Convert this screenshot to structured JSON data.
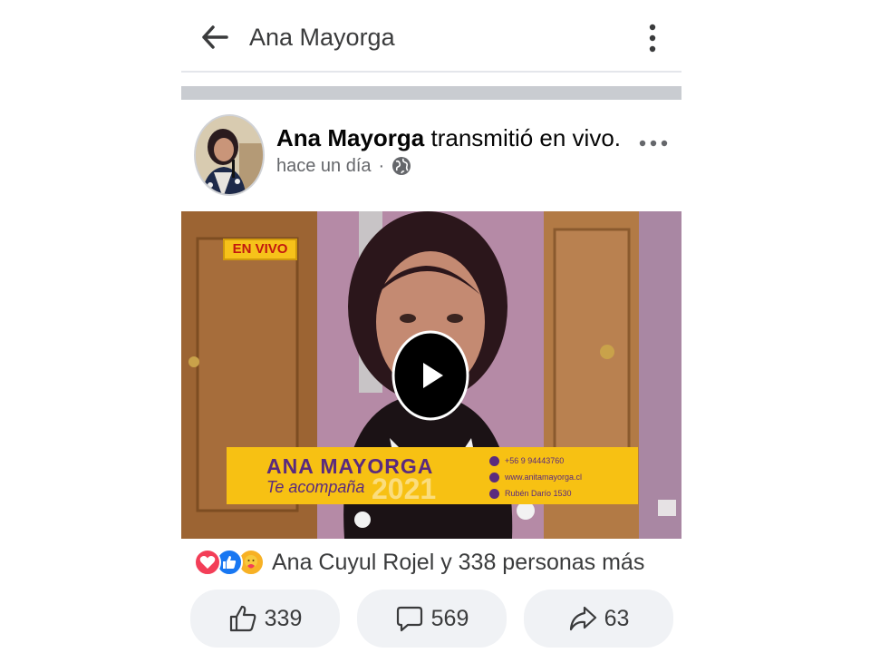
{
  "header": {
    "title": "Ana Mayorga",
    "back_icon": "arrow-left-icon",
    "menu_icon": "kebab-menu-icon"
  },
  "post": {
    "author": "Ana Mayorga",
    "action_text": " transmitió en vivo.",
    "timestamp": "hace un día",
    "separator": "·",
    "privacy_icon": "globe-icon",
    "more_icon": "more-horizontal-icon"
  },
  "video": {
    "live_badge": "EN VIVO",
    "banner_name": "ANA MAYORGA",
    "banner_subtitle": "Te acompaña",
    "banner_year": "2021",
    "contact_phone": "+56 9 94443760",
    "contact_web": "www.anitamayorga.cl",
    "contact_address": "Rubén Darío 1530",
    "play_icon": "play-icon"
  },
  "reactions": {
    "icons": [
      "love-reaction-icon",
      "like-reaction-icon",
      "care-reaction-icon"
    ],
    "summary": "Ana Cuyul Rojel y 338 personas más"
  },
  "actions": {
    "likes": "339",
    "comments": "569",
    "shares": "63"
  },
  "colors": {
    "like_blue": "#1877f2",
    "love_red": "#f33e58",
    "care_yellow": "#f7b125",
    "banner_yellow": "#f7c113",
    "banner_text": "#5a2a7e",
    "button_bg": "#f0f2f5"
  }
}
